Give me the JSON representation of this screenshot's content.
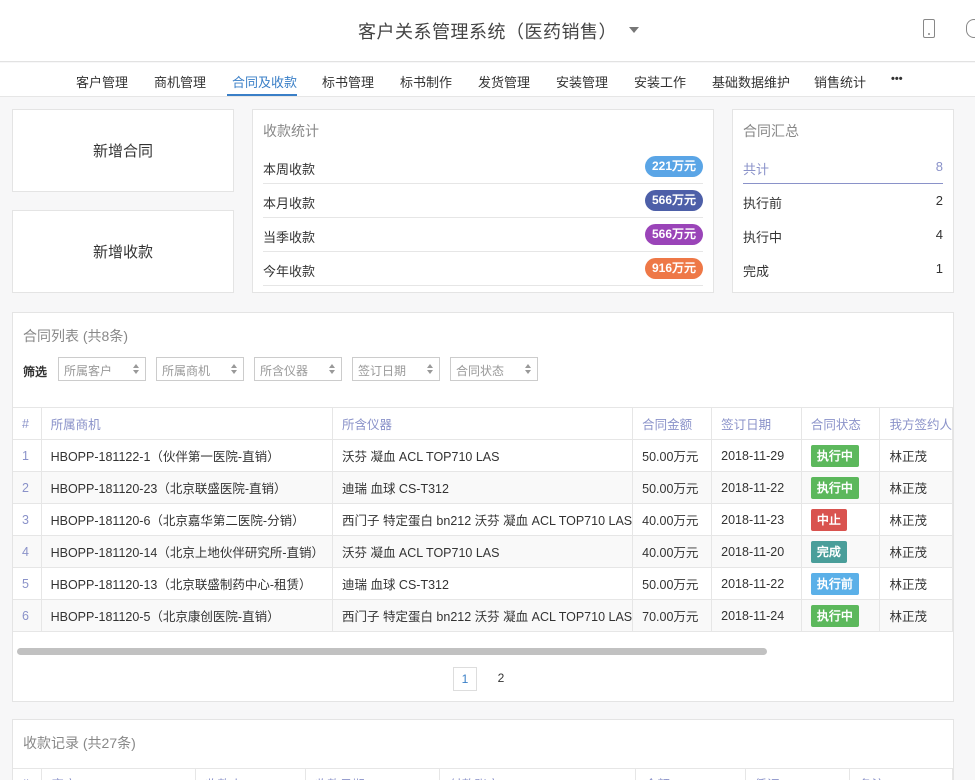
{
  "header": {
    "title": "客户关系管理系统（医药销售）",
    "icons": [
      "chevron-down-icon",
      "phone-icon"
    ]
  },
  "nav": {
    "items": [
      "客户管理",
      "商机管理",
      "合同及收款",
      "标书管理",
      "标书制作",
      "发货管理",
      "安装管理",
      "安装工作",
      "基础数据维护",
      "销售统计",
      "•••"
    ],
    "active_index": 2,
    "active_color": "#3a7fc7"
  },
  "actions": {
    "new_contract": "新增合同",
    "new_payment": "新增收款"
  },
  "payment_stats": {
    "title": "收款统计",
    "rows": [
      {
        "label": "本周收款",
        "value": "221万元",
        "color": "#5aa5e6"
      },
      {
        "label": "本月收款",
        "value": "566万元",
        "color": "#4d5fa8"
      },
      {
        "label": "当季收款",
        "value": "566万元",
        "color": "#9a44b8"
      },
      {
        "label": "今年收款",
        "value": "916万元",
        "color": "#ee7847"
      }
    ]
  },
  "contract_summary": {
    "title": "合同汇总",
    "rows": [
      {
        "label": "共计",
        "value": "8"
      },
      {
        "label": "执行前",
        "value": "2"
      },
      {
        "label": "执行中",
        "value": "4"
      },
      {
        "label": "完成",
        "value": "1"
      }
    ]
  },
  "contract_list": {
    "title": "合同列表 (共8条)",
    "filter_label": "筛选",
    "filters": [
      "所属客户",
      "所属商机",
      "所含仪器",
      "签订日期",
      "合同状态"
    ],
    "columns": [
      "#",
      "所属商机",
      "所含仪器",
      "合同金额",
      "签订日期",
      "合同状态",
      "我方签约人"
    ],
    "rows": [
      {
        "idx": "1",
        "opportunity": "HBOPP-181122-1（伙伴第一医院-直销）",
        "instruments": "沃芬 凝血 ACL TOP710 LAS",
        "amount": "50.00万元",
        "date": "2018-11-29",
        "status": "执行中",
        "status_color": "#5cb85c",
        "signer": "林正茂"
      },
      {
        "idx": "2",
        "opportunity": "HBOPP-181120-23（北京联盛医院-直销）",
        "instruments": "迪瑞 血球 CS-T312",
        "amount": "50.00万元",
        "date": "2018-11-22",
        "status": "执行中",
        "status_color": "#5cb85c",
        "signer": "林正茂"
      },
      {
        "idx": "3",
        "opportunity": "HBOPP-181120-6（北京嘉华第二医院-分销）",
        "instruments": "西门子 特定蛋白 bn212 沃芬 凝血 ACL TOP710 LAS",
        "amount": "40.00万元",
        "date": "2018-11-23",
        "status": "中止",
        "status_color": "#d9534f",
        "signer": "林正茂"
      },
      {
        "idx": "4",
        "opportunity": "HBOPP-181120-14（北京上地伙伴研究所-直销）",
        "instruments": "沃芬 凝血 ACL TOP710 LAS",
        "amount": "40.00万元",
        "date": "2018-11-20",
        "status": "完成",
        "status_color": "#4a9e9a",
        "signer": "林正茂"
      },
      {
        "idx": "5",
        "opportunity": "HBOPP-181120-13（北京联盛制药中心-租赁）",
        "instruments": "迪瑞 血球 CS-T312",
        "amount": "50.00万元",
        "date": "2018-11-22",
        "status": "执行前",
        "status_color": "#5bb0e8",
        "signer": "林正茂"
      },
      {
        "idx": "6",
        "opportunity": "HBOPP-181120-5（北京康创医院-直销）",
        "instruments": "西门子 特定蛋白 bn212 沃芬 凝血 ACL TOP710 LAS",
        "amount": "70.00万元",
        "date": "2018-11-24",
        "status": "执行中",
        "status_color": "#5cb85c",
        "signer": "林正茂"
      }
    ],
    "pagination": [
      "1",
      "2"
    ],
    "current_page": "1"
  },
  "payment_records": {
    "title": "收款记录 (共27条)",
    "columns": [
      "#",
      "客户",
      "收款人",
      "收款日期",
      "付款账户",
      "金额",
      "凭证",
      "备注"
    ]
  }
}
